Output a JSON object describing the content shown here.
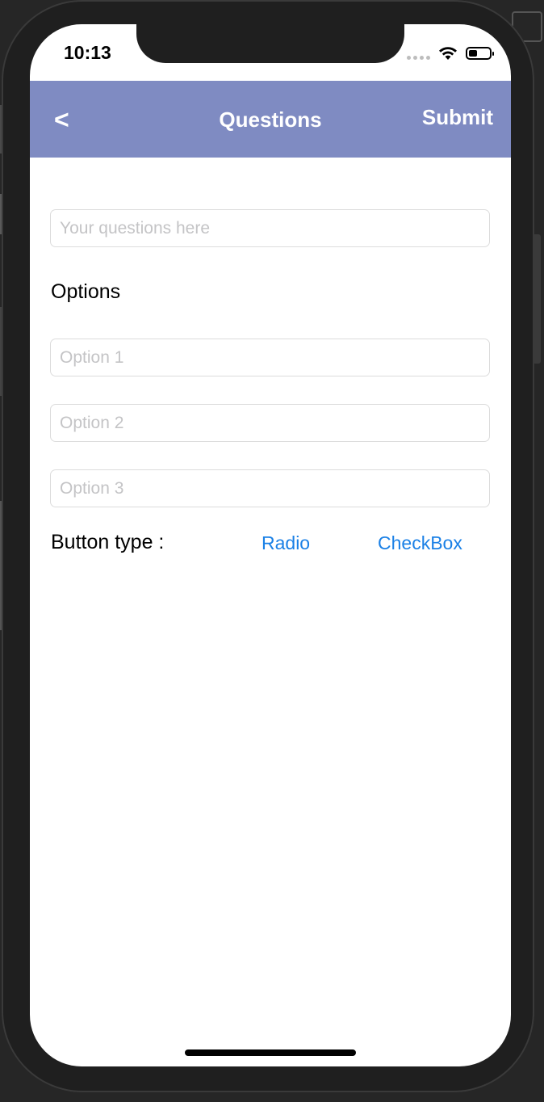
{
  "status_bar": {
    "time": "10:13",
    "battery_level": 0.4
  },
  "navbar": {
    "back_label": "<",
    "title": "Questions",
    "submit_label": "Submit",
    "background_color": "#7f8bc2"
  },
  "form": {
    "question": {
      "value": "",
      "placeholder": "Your questions here"
    },
    "options_heading": "Options",
    "options": [
      {
        "value": "",
        "placeholder": "Option 1"
      },
      {
        "value": "",
        "placeholder": "Option 2"
      },
      {
        "value": "",
        "placeholder": "Option 3"
      }
    ],
    "button_type_label": "Button type :",
    "radio_label": "Radio",
    "checkbox_label": "CheckBox",
    "link_color": "#1a80e6"
  },
  "icons": {
    "wifi": "wifi-icon",
    "signal": "cellular-signal-icon",
    "battery": "battery-icon"
  }
}
